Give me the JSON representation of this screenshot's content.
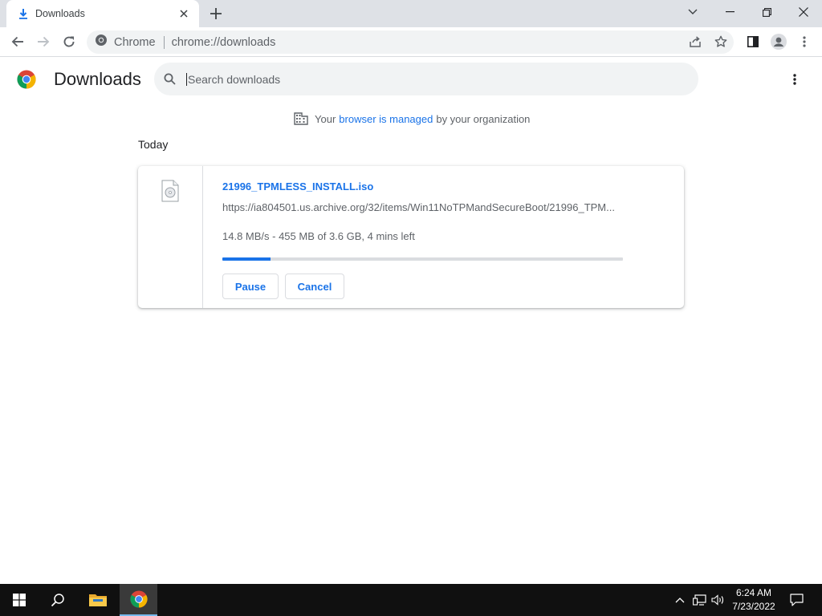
{
  "browser": {
    "tab_title": "Downloads",
    "site_chip": "Chrome",
    "url": "chrome://downloads"
  },
  "page": {
    "title": "Downloads",
    "search_placeholder": "Search downloads",
    "managed_prefix": "Your",
    "managed_link": "browser is managed",
    "managed_suffix": "by your organization",
    "date_header": "Today"
  },
  "download": {
    "file_name": "21996_TPMLESS_INSTALL.iso",
    "url": "https://ia804501.us.archive.org/32/items/Win11NoTPMandSecureBoot/21996_TPM...",
    "status": "14.8 MB/s - 455 MB of 3.6 GB, 4 mins left",
    "progress_percent": 12,
    "pause_label": "Pause",
    "cancel_label": "Cancel"
  },
  "taskbar": {
    "time": "6:24 AM",
    "date": "7/23/2022"
  },
  "colors": {
    "accent": "#1a73e8",
    "tabstrip": "#dee1e6",
    "taskbar": "#101010"
  }
}
